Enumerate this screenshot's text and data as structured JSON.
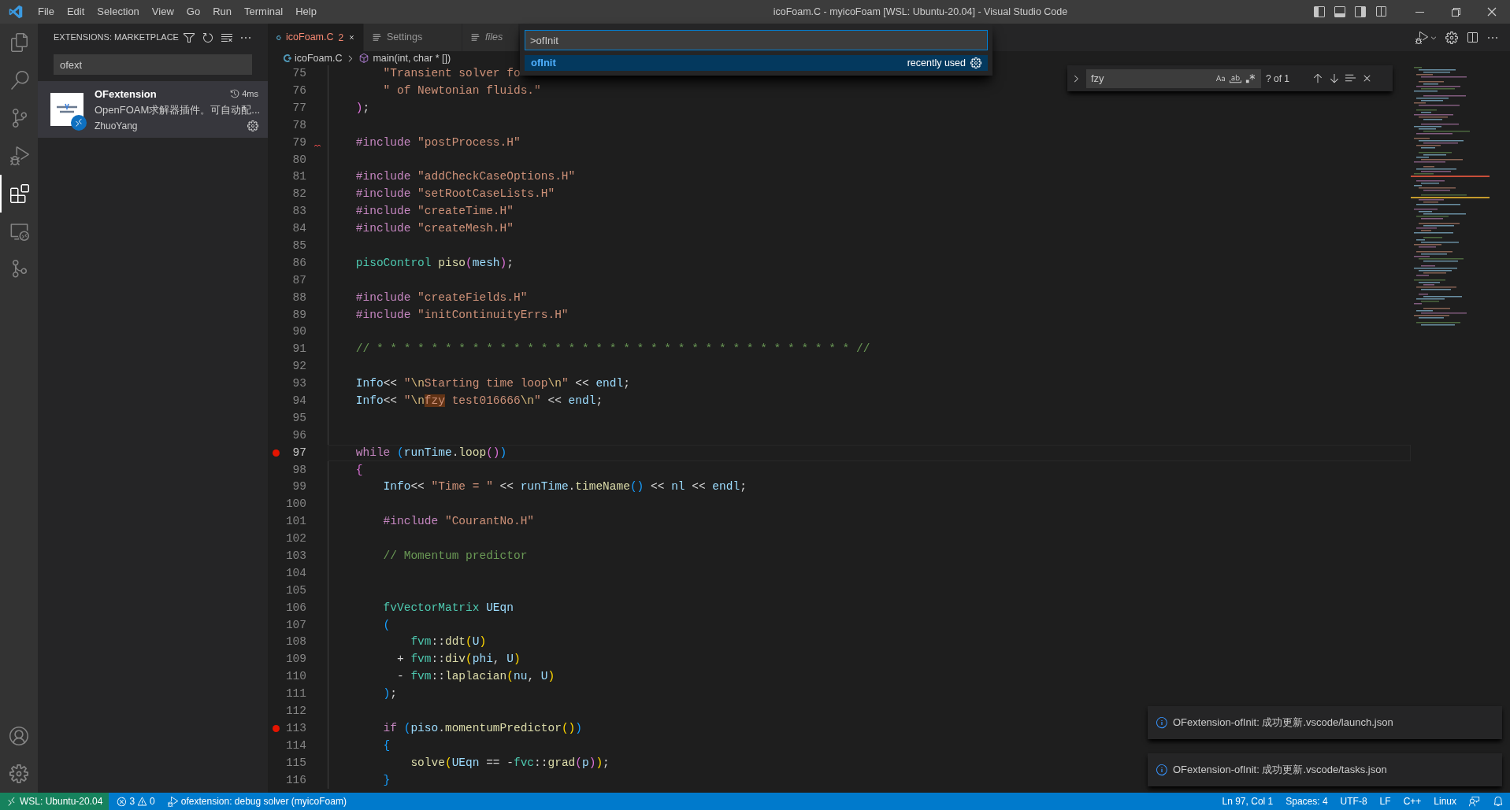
{
  "title_bar": {
    "menus": [
      "File",
      "Edit",
      "Selection",
      "View",
      "Go",
      "Run",
      "Terminal",
      "Help"
    ],
    "title": "icoFoam.C - myicoFoam [WSL: Ubuntu-20.04] - Visual Studio Code"
  },
  "activity_bar": {
    "items": [
      {
        "kind": "explorer",
        "selected": false
      },
      {
        "kind": "search",
        "selected": false
      },
      {
        "kind": "source",
        "selected": false
      },
      {
        "kind": "run",
        "selected": false
      },
      {
        "kind": "extensions",
        "selected": true
      },
      {
        "kind": "remote",
        "selected": false
      },
      {
        "kind": "graph",
        "selected": false
      }
    ]
  },
  "sidebar": {
    "title": "EXTENSIONS: MARKETPLACE",
    "search": {
      "value": "ofext"
    },
    "extensions": [
      {
        "name": "OFextension",
        "time": "4ms",
        "description": "OpenFOAM求解器插件。可自动配...",
        "author": "ZhuoYang",
        "selected": true
      }
    ]
  },
  "tabs": [
    {
      "label": "icoFoam.C",
      "badge": "2",
      "selected": true,
      "preview": false
    },
    {
      "label": "Settings",
      "selected": false,
      "preview": false
    },
    {
      "label": "files",
      "selected": false,
      "preview": true
    }
  ],
  "breadcrumb": [
    "icoFoam.C",
    "main(int, char * [])"
  ],
  "command_palette": {
    "value": ">ofInit",
    "items": [
      {
        "label": "ofInit",
        "detail": "recently used",
        "selected": true
      }
    ]
  },
  "find_widget": {
    "value": "fzy",
    "result": "? of 1"
  },
  "editor": {
    "lines": [
      {
        "number": "75",
        "tokens": [
          {
            "kind": "s",
            "text": "        \"Transient solver fo"
          }
        ]
      },
      {
        "number": "76",
        "tokens": [
          {
            "kind": "s",
            "text": "        \" of Newtonian fluids.\""
          }
        ]
      },
      {
        "number": "77",
        "tokens": [
          {
            "kind": "b",
            "text": "    )"
          },
          {
            "kind": "p",
            "text": ";"
          }
        ]
      },
      {
        "number": "78"
      },
      {
        "number": "79",
        "error_mark": true,
        "tokens": [
          {
            "kind": "pp",
            "text": "    #include"
          },
          {
            "kind": "s",
            "text": " \"postProcess.H\""
          }
        ]
      },
      {
        "number": "80"
      },
      {
        "number": "81",
        "tokens": [
          {
            "kind": "pp",
            "text": "    #include"
          },
          {
            "kind": "s",
            "text": " \"addCheckCaseOptions.H\""
          }
        ]
      },
      {
        "number": "82",
        "tokens": [
          {
            "kind": "pp",
            "text": "    #include"
          },
          {
            "kind": "s",
            "text": " \"setRootCaseLists.H\""
          }
        ]
      },
      {
        "number": "83",
        "tokens": [
          {
            "kind": "pp",
            "text": "    #include"
          },
          {
            "kind": "s",
            "text": " \"createTime.H\""
          }
        ]
      },
      {
        "number": "84",
        "tokens": [
          {
            "kind": "pp",
            "text": "    #include"
          },
          {
            "kind": "s",
            "text": " \"createMesh.H\""
          }
        ]
      },
      {
        "number": "85"
      },
      {
        "number": "86",
        "tokens": [
          {
            "kind": "t",
            "text": "    pisoControl"
          },
          {
            "kind": "f",
            "text": " piso"
          },
          {
            "kind": "b",
            "text": "("
          },
          {
            "kind": "v",
            "text": "mesh"
          },
          {
            "kind": "b",
            "text": ")"
          },
          {
            "kind": "p",
            "text": ";"
          }
        ]
      },
      {
        "number": "87"
      },
      {
        "number": "88",
        "tokens": [
          {
            "kind": "pp",
            "text": "    #include"
          },
          {
            "kind": "s",
            "text": " \"createFields.H\""
          }
        ]
      },
      {
        "number": "89",
        "tokens": [
          {
            "kind": "pp",
            "text": "    #include"
          },
          {
            "kind": "s",
            "text": " \"initContinuityErrs.H\""
          }
        ]
      },
      {
        "number": "90"
      },
      {
        "number": "91",
        "tokens": [
          {
            "kind": "c",
            "text": "    // * * * * * * * * * * * * * * * * * * * * * * * * * * * * * * * * * * * //"
          }
        ]
      },
      {
        "number": "92"
      },
      {
        "number": "93",
        "tokens": [
          {
            "kind": "v",
            "text": "    Info"
          },
          {
            "kind": "p",
            "text": "<< "
          },
          {
            "kind": "s",
            "text": "\""
          },
          {
            "kind": "e",
            "text": "\\n"
          },
          {
            "kind": "s",
            "text": "Starting time loop"
          },
          {
            "kind": "e",
            "text": "\\n"
          },
          {
            "kind": "s",
            "text": "\""
          },
          {
            "kind": "p",
            "text": " << "
          },
          {
            "kind": "v",
            "text": "endl"
          },
          {
            "kind": "p",
            "text": ";"
          }
        ]
      },
      {
        "number": "94",
        "tokens": [
          {
            "kind": "v",
            "text": "    Info"
          },
          {
            "kind": "p",
            "text": "<< "
          },
          {
            "kind": "s",
            "text": "\""
          },
          {
            "kind": "e",
            "text": "\\n"
          },
          {
            "kind": "m",
            "text": "fzy"
          },
          {
            "kind": "s",
            "text": " test016666"
          },
          {
            "kind": "e",
            "text": "\\n"
          },
          {
            "kind": "s",
            "text": "\""
          },
          {
            "kind": "p",
            "text": " << "
          },
          {
            "kind": "v",
            "text": "endl"
          },
          {
            "kind": "p",
            "text": ";"
          }
        ]
      },
      {
        "number": "95"
      },
      {
        "number": "96"
      },
      {
        "number": "97",
        "current": true,
        "breakpoint": true,
        "tokens": [
          {
            "kind": "k",
            "text": "    while"
          },
          {
            "kind": "b2",
            "text": " ("
          },
          {
            "kind": "v",
            "text": "runTime"
          },
          {
            "kind": "p",
            "text": "."
          },
          {
            "kind": "f",
            "text": "loop"
          },
          {
            "kind": "b",
            "text": "()"
          },
          {
            "kind": "b2",
            "text": ")"
          }
        ]
      },
      {
        "number": "98",
        "tokens": [
          {
            "kind": "b",
            "text": "    {"
          }
        ]
      },
      {
        "number": "99",
        "tokens": [
          {
            "kind": "v",
            "text": "        Info"
          },
          {
            "kind": "p",
            "text": "<< "
          },
          {
            "kind": "s",
            "text": "\"Time = \""
          },
          {
            "kind": "p",
            "text": " << "
          },
          {
            "kind": "v",
            "text": "runTime"
          },
          {
            "kind": "p",
            "text": "."
          },
          {
            "kind": "f",
            "text": "timeName"
          },
          {
            "kind": "b2",
            "text": "()"
          },
          {
            "kind": "p",
            "text": " << "
          },
          {
            "kind": "v",
            "text": "nl"
          },
          {
            "kind": "p",
            "text": " << "
          },
          {
            "kind": "v",
            "text": "endl"
          },
          {
            "kind": "p",
            "text": ";"
          }
        ]
      },
      {
        "number": "100"
      },
      {
        "number": "101",
        "tokens": [
          {
            "kind": "pp",
            "text": "        #include"
          },
          {
            "kind": "s",
            "text": " \"CourantNo.H\""
          }
        ]
      },
      {
        "number": "102"
      },
      {
        "number": "103",
        "tokens": [
          {
            "kind": "c",
            "text": "        // Momentum predictor"
          }
        ]
      },
      {
        "number": "104"
      },
      {
        "number": "105"
      },
      {
        "number": "106",
        "tokens": [
          {
            "kind": "t",
            "text": "        fvVectorMatrix"
          },
          {
            "kind": "v",
            "text": " UEqn"
          }
        ]
      },
      {
        "number": "107",
        "tokens": [
          {
            "kind": "b2",
            "text": "        ("
          }
        ]
      },
      {
        "number": "108",
        "tokens": [
          {
            "kind": "t",
            "text": "            fvm"
          },
          {
            "kind": "p",
            "text": "::"
          },
          {
            "kind": "f",
            "text": "ddt"
          },
          {
            "kind": "g",
            "text": "("
          },
          {
            "kind": "v",
            "text": "U"
          },
          {
            "kind": "g",
            "text": ")"
          }
        ]
      },
      {
        "number": "109",
        "tokens": [
          {
            "kind": "p",
            "text": "          + "
          },
          {
            "kind": "t",
            "text": "fvm"
          },
          {
            "kind": "p",
            "text": "::"
          },
          {
            "kind": "f",
            "text": "div"
          },
          {
            "kind": "g",
            "text": "("
          },
          {
            "kind": "v",
            "text": "phi"
          },
          {
            "kind": "p",
            "text": ", "
          },
          {
            "kind": "v",
            "text": "U"
          },
          {
            "kind": "g",
            "text": ")"
          }
        ]
      },
      {
        "number": "110",
        "tokens": [
          {
            "kind": "p",
            "text": "          - "
          },
          {
            "kind": "t",
            "text": "fvm"
          },
          {
            "kind": "p",
            "text": "::"
          },
          {
            "kind": "f",
            "text": "laplacian"
          },
          {
            "kind": "g",
            "text": "("
          },
          {
            "kind": "v",
            "text": "nu"
          },
          {
            "kind": "p",
            "text": ", "
          },
          {
            "kind": "v",
            "text": "U"
          },
          {
            "kind": "g",
            "text": ")"
          }
        ]
      },
      {
        "number": "111",
        "tokens": [
          {
            "kind": "b2",
            "text": "        )"
          },
          {
            "kind": "p",
            "text": ";"
          }
        ]
      },
      {
        "number": "112"
      },
      {
        "number": "113",
        "breakpoint": true,
        "tokens": [
          {
            "kind": "k",
            "text": "        if"
          },
          {
            "kind": "b2",
            "text": " ("
          },
          {
            "kind": "v",
            "text": "piso"
          },
          {
            "kind": "p",
            "text": "."
          },
          {
            "kind": "f",
            "text": "momentumPredictor"
          },
          {
            "kind": "g",
            "text": "()"
          },
          {
            "kind": "b2",
            "text": ")"
          }
        ]
      },
      {
        "number": "114",
        "tokens": [
          {
            "kind": "b2",
            "text": "        {"
          }
        ]
      },
      {
        "number": "115",
        "tokens": [
          {
            "kind": "f",
            "text": "            solve"
          },
          {
            "kind": "g",
            "text": "("
          },
          {
            "kind": "v",
            "text": "UEqn"
          },
          {
            "kind": "p",
            "text": " == -"
          },
          {
            "kind": "t",
            "text": "fvc"
          },
          {
            "kind": "p",
            "text": "::"
          },
          {
            "kind": "f",
            "text": "grad"
          },
          {
            "kind": "b",
            "text": "("
          },
          {
            "kind": "v",
            "text": "p"
          },
          {
            "kind": "b",
            "text": ")"
          },
          {
            "kind": "g",
            "text": ")"
          },
          {
            "kind": "p",
            "text": ";"
          }
        ]
      },
      {
        "number": "116",
        "tokens": [
          {
            "kind": "b2",
            "text": "        }"
          }
        ]
      }
    ]
  },
  "notifications": [
    "OFextension-ofInit: 成功更新.vscode/launch.json",
    "OFextension-ofInit: 成功更新.vscode/tasks.json"
  ],
  "status_bar": {
    "remote": "WSL: Ubuntu-20.04",
    "errors": "3",
    "warnings": "0",
    "debug": "ofextension: debug solver (myicoFoam)",
    "right": [
      "Ln 97, Col 1",
      "Spaces: 4",
      "UTF-8",
      "LF",
      "C++",
      "Linux"
    ]
  }
}
